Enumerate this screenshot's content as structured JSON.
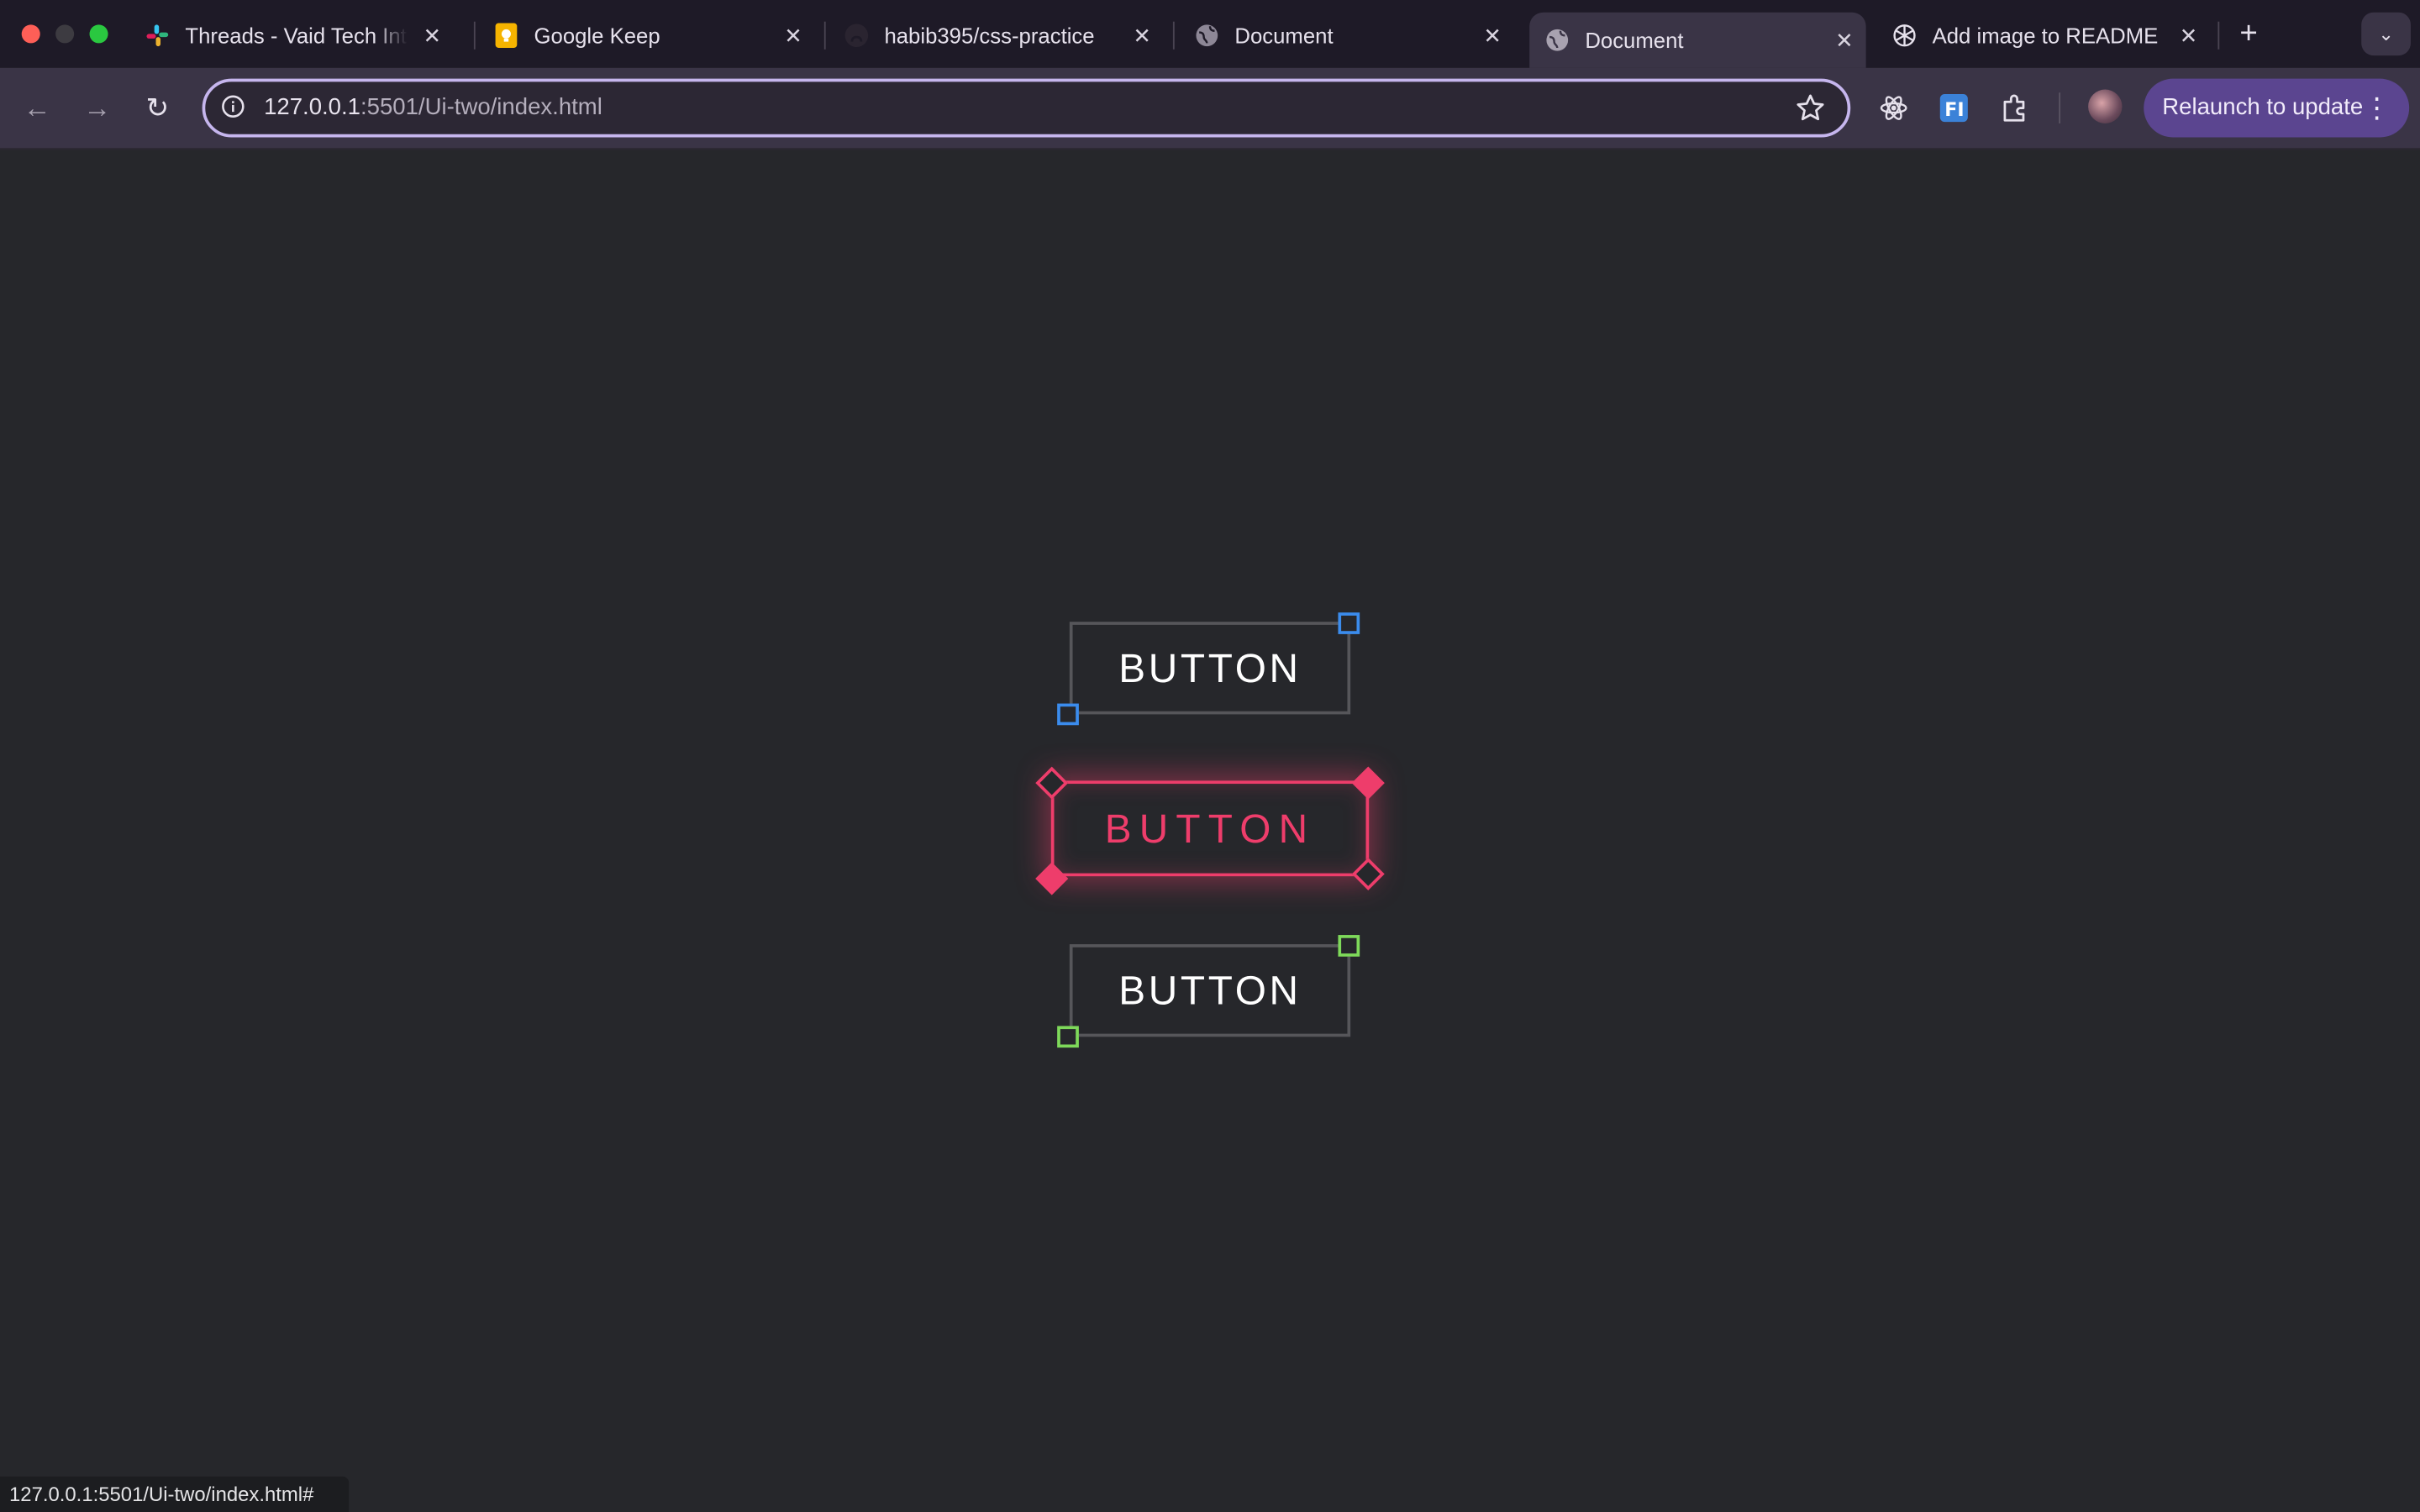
{
  "tabs": [
    {
      "title": "Threads - Vaid Tech Inte",
      "icon": "slack-icon",
      "active": false
    },
    {
      "title": "Google Keep",
      "icon": "google-keep-icon",
      "active": false
    },
    {
      "title": "habib395/css-practice",
      "icon": "github-icon",
      "active": false
    },
    {
      "title": "Document",
      "icon": "globe-icon",
      "active": false
    },
    {
      "title": "Document",
      "icon": "globe-icon",
      "active": true
    },
    {
      "title": "Add image to README",
      "icon": "chatgpt-icon",
      "active": false
    }
  ],
  "toolbar": {
    "url_host": "127.0.0.1",
    "url_rest": ":5501/Ui-two/index.html",
    "relaunch_label": "Relaunch to update",
    "extensions": [
      "react-devtools-icon",
      "fi-extension-icon",
      "puzzle-extensions-icon"
    ]
  },
  "content": {
    "buttons": [
      {
        "label": "BUTTON",
        "accent": "#3b8ced",
        "state": "normal"
      },
      {
        "label": "BUTTON",
        "accent": "#ee3d6b",
        "state": "hovered"
      },
      {
        "label": "BUTTON",
        "accent": "#7ed95a",
        "state": "normal"
      }
    ]
  },
  "statusbar": {
    "text": "127.0.0.1:5501/Ui-two/index.html#"
  },
  "colors": {
    "page_bg": "#26272b",
    "tabstrip_bg": "#1e1a27",
    "toolbar_bg": "#3a3446",
    "omnibox_border": "#c6b6ee",
    "relaunch_bg": "#5b4590"
  }
}
